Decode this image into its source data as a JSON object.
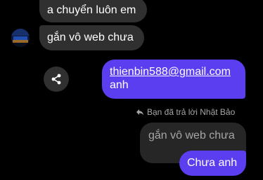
{
  "conversation": {
    "incoming": [
      {
        "text": "a chuyển luôn em"
      },
      {
        "text": "gắn vô web chưa"
      }
    ],
    "outgoing_link": {
      "email": "thienbin588@gmail.com",
      "trailing": "anh"
    },
    "reply_context": {
      "label": "Bạn đã trả lời Nhật Bảo",
      "quoted_text": "gắn vô web chưa"
    },
    "outgoing_reply": {
      "text": "Chưa anh"
    }
  },
  "colors": {
    "background": "#000000",
    "incoming_bubble": "#303030",
    "outgoing_bubble": "#5b3ef0",
    "quoted_bubble": "#262626",
    "muted_text": "#a6a6a6"
  },
  "icons": {
    "share": "share-icon",
    "reply": "reply-arrow-icon",
    "avatar": "contact-avatar"
  }
}
